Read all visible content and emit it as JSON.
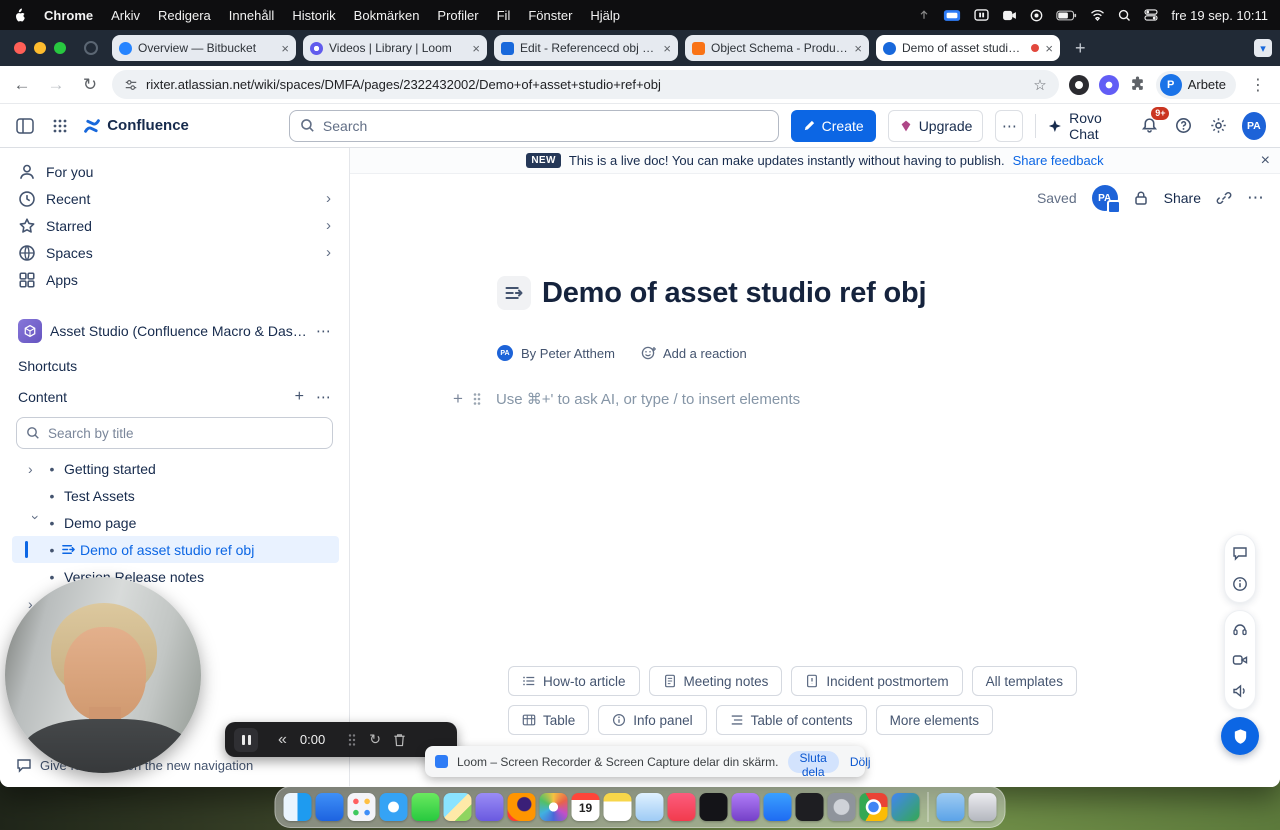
{
  "colors": {
    "accent_blue": "#0c66e4",
    "selected_bg": "#e9f2ff",
    "badge_red": "#ca3521",
    "recording_red": "#e2483d",
    "upgrade_gem": "#ae4787"
  },
  "menubar": {
    "items": [
      "Chrome",
      "Arkiv",
      "Redigera",
      "Innehåll",
      "Historik",
      "Bokmärken",
      "Profiler",
      "Fil",
      "Fönster",
      "Hjälp"
    ],
    "clock": "fre 19 sep. 10:11"
  },
  "browser": {
    "tabs": [
      {
        "title": "Overview — Bitbucket"
      },
      {
        "title": "Videos | Library | Loom"
      },
      {
        "title": "Edit - Referencecd obj - Jira"
      },
      {
        "title": "Object Schema - Product Off..."
      },
      {
        "title": "Demo of asset studio ref"
      }
    ],
    "url": "rixter.atlassian.net/wiki/spaces/DMFA/pages/2322432002/Demo+of+asset+studio+ref+obj",
    "profile_name": "Arbete",
    "profile_initial": "P"
  },
  "nav": {
    "product": "Confluence",
    "search_placeholder": "Search",
    "create_label": "Create",
    "upgrade_label": "Upgrade",
    "rovo_label": "Rovo Chat",
    "notification_count": "9+"
  },
  "banner": {
    "badge": "NEW",
    "message": "This is a live doc! You can make updates instantly without having to publish.",
    "link": "Share feedback"
  },
  "sidebar": {
    "items": [
      {
        "label": "For you"
      },
      {
        "label": "Recent"
      },
      {
        "label": "Starred"
      },
      {
        "label": "Spaces"
      },
      {
        "label": "Apps"
      }
    ],
    "space_name": "Asset Studio (Confluence Macro & Dashboard ...",
    "shortcuts_label": "Shortcuts",
    "content_label": "Content",
    "search_placeholder": "Search by title",
    "tree": [
      {
        "label": "Getting started"
      },
      {
        "label": "Test Assets"
      },
      {
        "label": "Demo page"
      },
      {
        "label": "Demo of asset studio ref obj"
      },
      {
        "label": "Version Release notes"
      }
    ],
    "feedback_label": "Give feedback on the new navigation"
  },
  "page": {
    "status": "Saved",
    "share_label": "Share",
    "avatar_initials": "PA",
    "title": "Demo of asset studio ref obj",
    "byline": "By Peter Atthem",
    "reaction_label": "Add a reaction",
    "editor_placeholder": "Use ⌘+' to ask AI, or type / to insert elements"
  },
  "templates": {
    "row1": [
      "How-to article",
      "Meeting notes",
      "Incident postmortem",
      "All templates"
    ],
    "row2": [
      "Table",
      "Info panel",
      "Table of contents",
      "More elements"
    ]
  },
  "recorder": {
    "time": "0:00"
  },
  "share_bar": {
    "message": "Loom – Screen Recorder & Screen Capture delar din skärm.",
    "stop_label": "Sluta dela",
    "hide_label": "Dölj"
  },
  "dock": {
    "calendar_day": "19"
  }
}
